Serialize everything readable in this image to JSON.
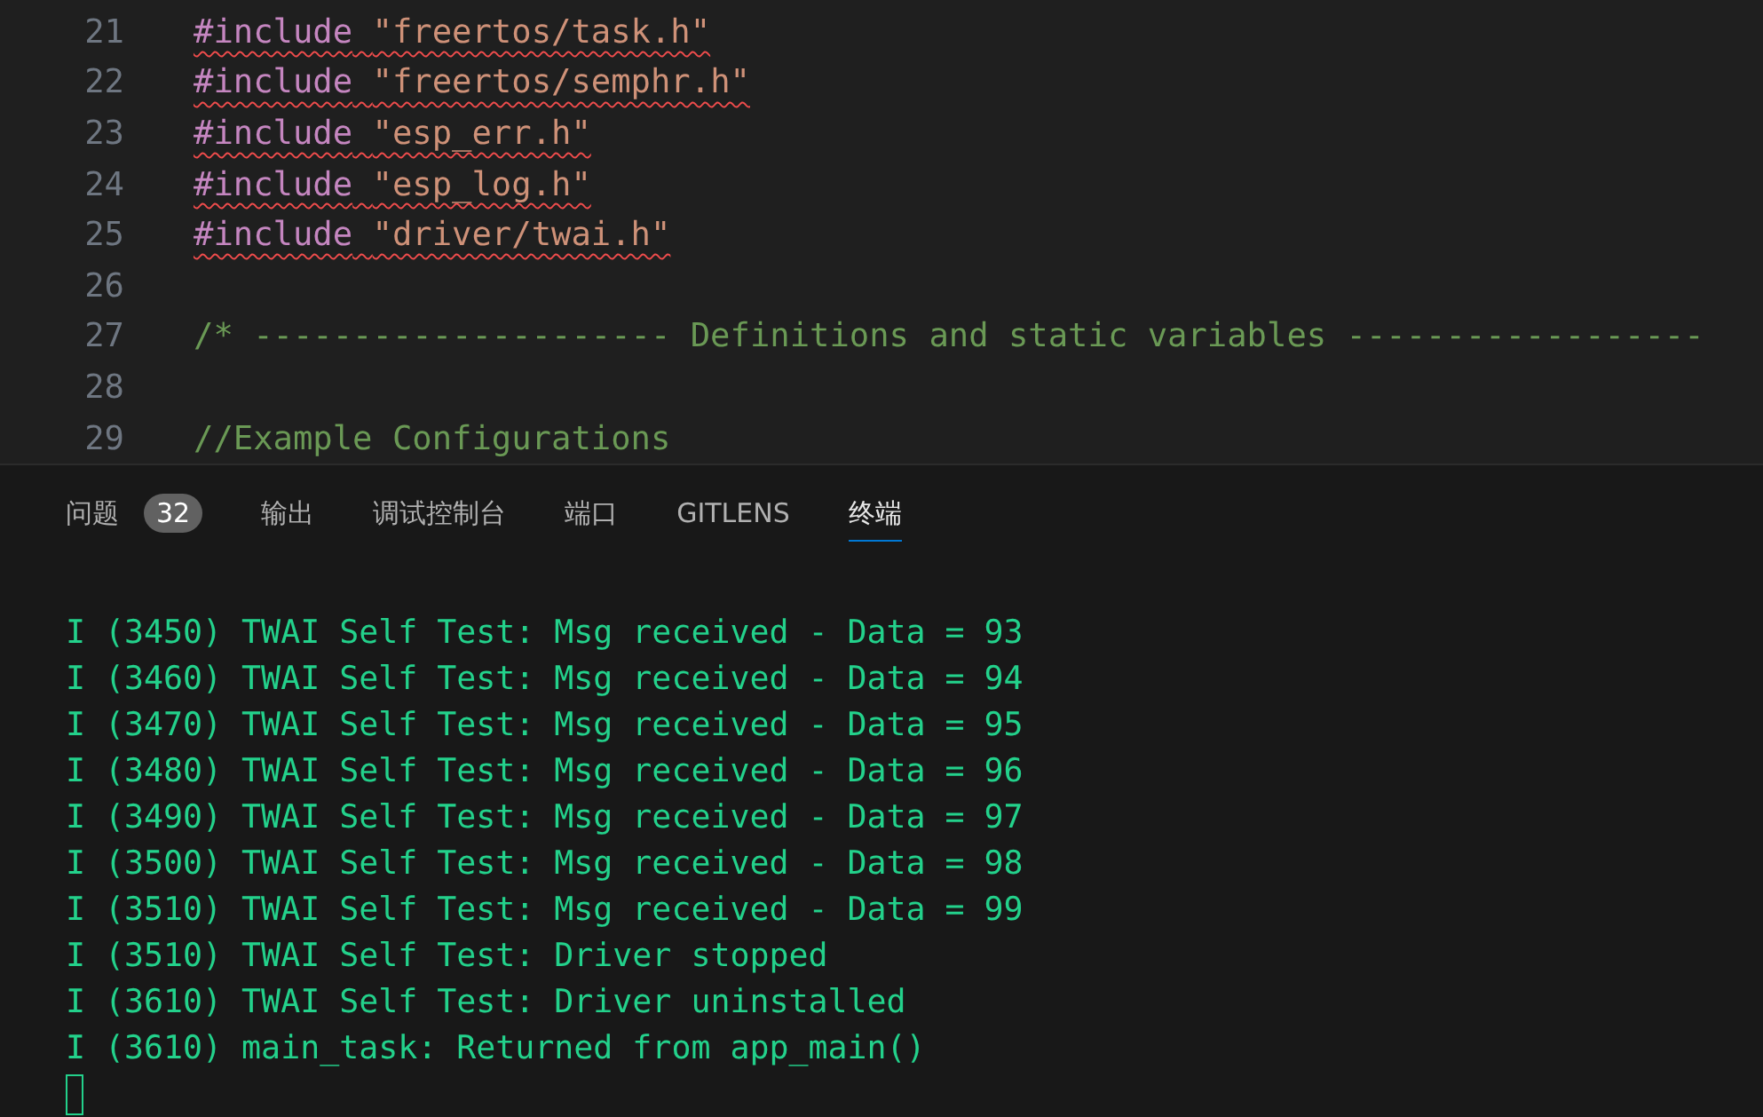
{
  "editor": {
    "lines": [
      {
        "number": "21",
        "kind": "include",
        "keyword": "#include",
        "path": "\"freertos/task.h\"",
        "error": true
      },
      {
        "number": "22",
        "kind": "include",
        "keyword": "#include",
        "path": "\"freertos/semphr.h\"",
        "error": true
      },
      {
        "number": "23",
        "kind": "include",
        "keyword": "#include",
        "path": "\"esp_err.h\"",
        "error": true
      },
      {
        "number": "24",
        "kind": "include",
        "keyword": "#include",
        "path": "\"esp_log.h\"",
        "error": true
      },
      {
        "number": "25",
        "kind": "include",
        "keyword": "#include",
        "path": "\"driver/twai.h\"",
        "error": true
      },
      {
        "number": "26",
        "kind": "blank"
      },
      {
        "number": "27",
        "kind": "comment",
        "text": "/* --------------------- Definitions and static variables ------------------"
      },
      {
        "number": "28",
        "kind": "blank"
      },
      {
        "number": "29",
        "kind": "comment",
        "text": "//Example Configurations"
      }
    ]
  },
  "panel": {
    "tabs": [
      {
        "label": "问题",
        "badge": "32",
        "selected": false
      },
      {
        "label": "输出",
        "selected": false
      },
      {
        "label": "调试控制台",
        "selected": false
      },
      {
        "label": "端口",
        "selected": false
      },
      {
        "label": "GITLENS",
        "selected": false
      },
      {
        "label": "终端",
        "selected": true
      }
    ],
    "terminal": {
      "lines": [
        "I (3450) TWAI Self Test: Msg received - Data = 93",
        "I (3460) TWAI Self Test: Msg received - Data = 94",
        "I (3470) TWAI Self Test: Msg received - Data = 95",
        "I (3480) TWAI Self Test: Msg received - Data = 96",
        "I (3490) TWAI Self Test: Msg received - Data = 97",
        "I (3500) TWAI Self Test: Msg received - Data = 98",
        "I (3510) TWAI Self Test: Msg received - Data = 99",
        "I (3510) TWAI Self Test: Driver stopped",
        "I (3610) TWAI Self Test: Driver uninstalled",
        "I (3610) main_task: Returned from app_main()"
      ],
      "cursor": true
    }
  }
}
